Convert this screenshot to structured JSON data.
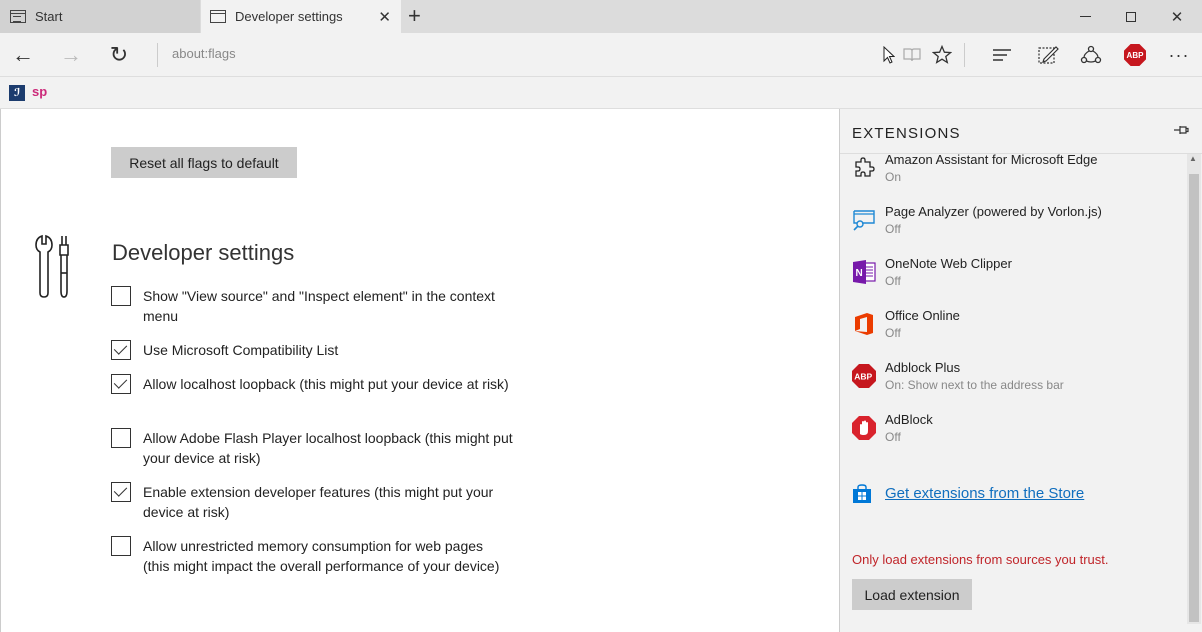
{
  "tabs": [
    {
      "label": "Start"
    },
    {
      "label": "Developer settings"
    }
  ],
  "tab_controls": {
    "close": "✕",
    "new_tab": "+"
  },
  "window_controls": {
    "close": "✕"
  },
  "nav": {
    "back": "←",
    "forward": "→",
    "refresh": "↻",
    "address": "about:flags",
    "more": "···"
  },
  "favorites": [
    {
      "label": "ℐ"
    },
    {
      "label": "sp"
    }
  ],
  "main": {
    "reset_label": "Reset all flags to default",
    "section_title": "Developer settings",
    "options": [
      {
        "label": "Show \"View source\" and \"Inspect element\" in the context menu",
        "checked": false
      },
      {
        "label": "Use Microsoft Compatibility List",
        "checked": true
      },
      {
        "label": "Allow localhost loopback (this might put your device at risk)",
        "checked": true
      },
      {
        "label": "Allow Adobe Flash Player localhost loopback (this might put your device at risk)",
        "checked": false
      },
      {
        "label": "Enable extension developer features (this might put your device at risk)",
        "checked": true
      },
      {
        "label": "Allow unrestricted memory consumption for web pages (this might impact the overall performance of your device)",
        "checked": false
      }
    ]
  },
  "extensions_panel": {
    "title": "EXTENSIONS",
    "items": [
      {
        "name": "Amazon Assistant for Microsoft Edge",
        "status": "On",
        "icon": "puzzle-icon"
      },
      {
        "name": "Page Analyzer (powered by Vorlon.js)",
        "status": "Off",
        "icon": "page-analyzer-icon"
      },
      {
        "name": "OneNote Web Clipper",
        "status": "Off",
        "icon": "onenote-icon"
      },
      {
        "name": "Office Online",
        "status": "Off",
        "icon": "office-icon"
      },
      {
        "name": "Adblock Plus",
        "status": "On: Show next to the address bar",
        "icon": "abp-icon"
      },
      {
        "name": "AdBlock",
        "status": "Off",
        "icon": "adblock-hand-icon"
      }
    ],
    "store_link": "Get extensions from the Store",
    "warning": "Only load extensions from sources you trust.",
    "load_label": "Load extension",
    "abp_badge": "ABP"
  },
  "colors": {
    "link": "#106ebe",
    "warning": "#c0252a",
    "abp_red": "#c6171e",
    "onenote_purple": "#7719aa",
    "office_orange": "#eb3c00"
  }
}
